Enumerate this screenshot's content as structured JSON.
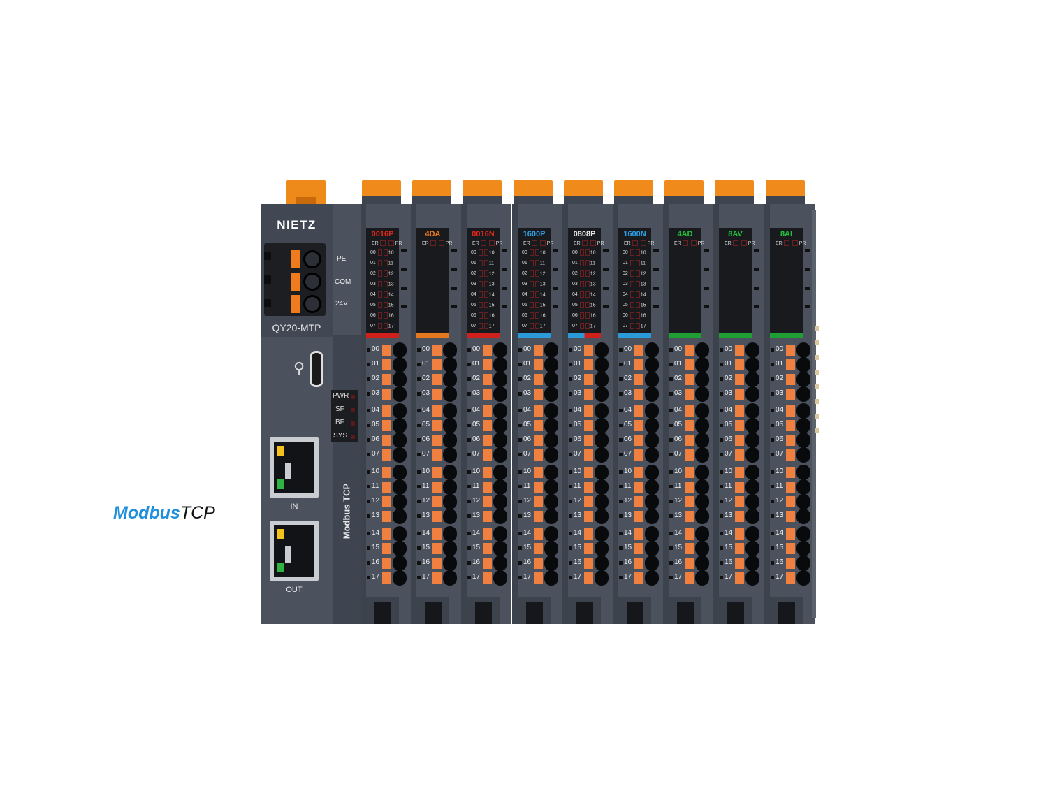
{
  "logo": {
    "part1": "Modbus",
    "part2": "TCP"
  },
  "coupler": {
    "brand": "NIETZ",
    "model": "QY20-MTP",
    "power_labels": [
      "PE",
      "COM",
      "24V"
    ],
    "status_leds": [
      "PWR",
      "SF",
      "BF",
      "SYS"
    ],
    "protocol_label": "Modbus TCP",
    "port_in": "IN",
    "port_out": "OUT"
  },
  "modules": [
    {
      "name": "0016P",
      "color": "#e0261a",
      "strip": [
        "#d0201c"
      ],
      "channels": true
    },
    {
      "name": "4DA",
      "color": "#f07a1a",
      "strip": [
        "#e6791f"
      ],
      "channels": false
    },
    {
      "name": "0016N",
      "color": "#e0261a",
      "strip": [
        "#d0201c"
      ],
      "channels": true
    },
    {
      "name": "1600P",
      "color": "#2ca0e6",
      "strip": [
        "#2b9ad8"
      ],
      "channels": true
    },
    {
      "name": "0808P",
      "color": "#e8e8e8",
      "strip": [
        "#2b9ad8",
        "#d0201c"
      ],
      "channels": true
    },
    {
      "name": "1600N",
      "color": "#2ca0e6",
      "strip": [
        "#2b9ad8"
      ],
      "channels": true
    },
    {
      "name": "4AD",
      "color": "#23c23a",
      "strip": [
        "#1f9e34"
      ],
      "channels": false
    },
    {
      "name": "8AV",
      "color": "#23c23a",
      "strip": [
        "#1f9e34"
      ],
      "channels": false
    },
    {
      "name": "8AI",
      "color": "#23c23a",
      "strip": [
        "#1f9e34"
      ],
      "channels": false
    }
  ],
  "er_label": "ER",
  "pr_label": "PR",
  "display_channels_left": [
    "00",
    "01",
    "02",
    "03",
    "04",
    "05",
    "06",
    "07"
  ],
  "display_channels_right": [
    "10",
    "11",
    "12",
    "13",
    "14",
    "15",
    "16",
    "17"
  ],
  "terminal_labels": [
    "00",
    "01",
    "02",
    "03",
    "04",
    "05",
    "06",
    "07",
    "10",
    "11",
    "12",
    "13",
    "14",
    "15",
    "16",
    "17"
  ]
}
